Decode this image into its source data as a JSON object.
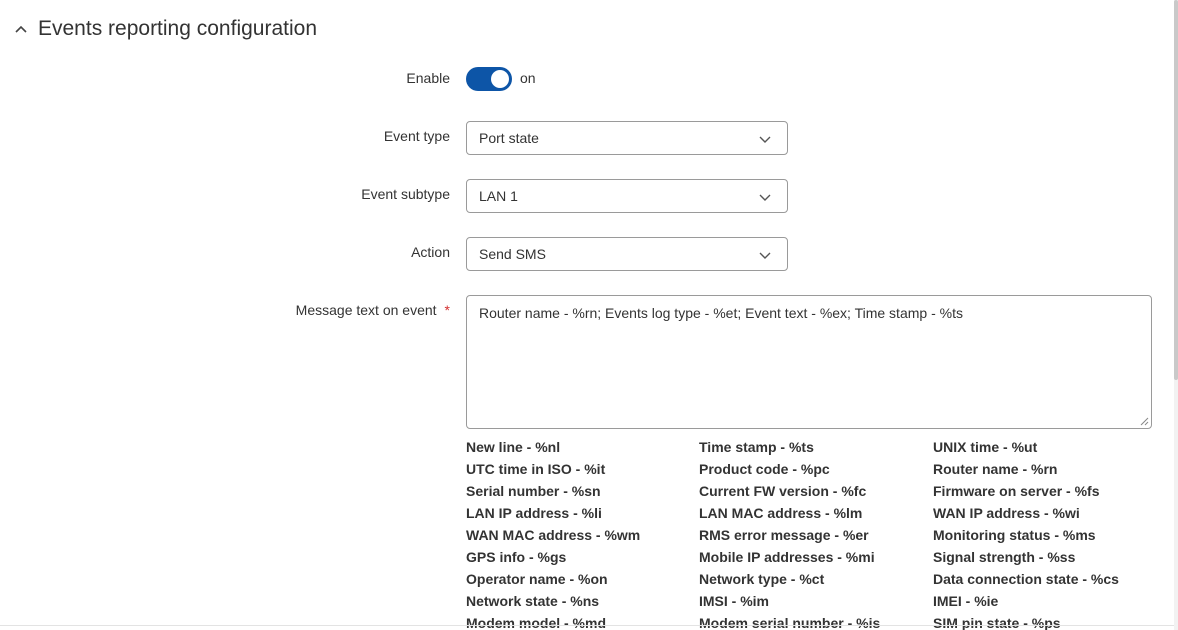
{
  "section": {
    "title": "Events reporting configuration",
    "icon": "chevron-up-icon"
  },
  "enable": {
    "label": "Enable",
    "state": "on",
    "on": true,
    "accent": "#0d55a7"
  },
  "event_type": {
    "label": "Event type",
    "value": "Port state"
  },
  "event_subtype": {
    "label": "Event subtype",
    "value": "LAN 1"
  },
  "action": {
    "label": "Action",
    "value": "Send SMS"
  },
  "message": {
    "label": "Message text on event",
    "required_mark": "*",
    "value": "Router name - %rn; Events log type - %et; Event text - %ex; Time stamp - %ts"
  },
  "variables": [
    "New line - %nl",
    "Time stamp - %ts",
    "UNIX time - %ut",
    "UTC time in ISO - %it",
    "Product code - %pc",
    "Router name - %rn",
    "Serial number - %sn",
    "Current FW version - %fc",
    "Firmware on server - %fs",
    "LAN IP address - %li",
    "LAN MAC address - %lm",
    "WAN IP address - %wi",
    "WAN MAC address - %wm",
    "RMS error message - %er",
    "Monitoring status - %ms",
    "GPS info - %gs",
    "Mobile IP addresses - %mi",
    "Signal strength - %ss",
    "Operator name - %on",
    "Network type - %ct",
    "Data connection state - %cs",
    "Network state - %ns",
    "IMSI - %im",
    "IMEI - %ie",
    "Modem model - %md",
    "Modem serial number - %is",
    "SIM pin state - %ps"
  ]
}
